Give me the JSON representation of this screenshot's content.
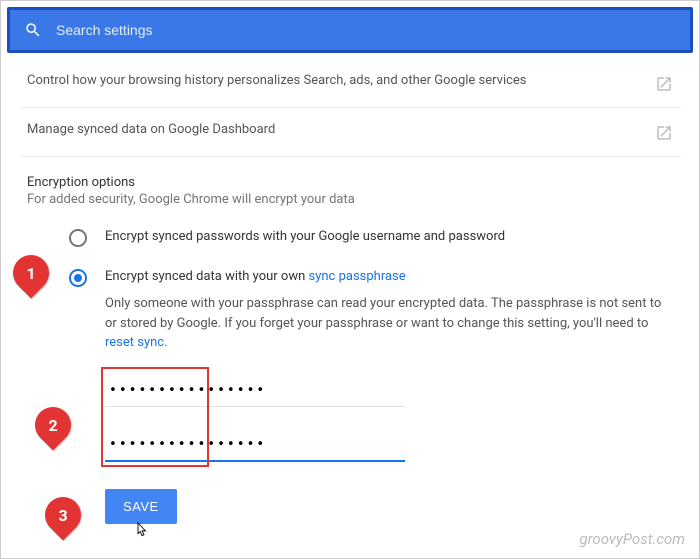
{
  "search": {
    "placeholder": "Search settings"
  },
  "row1": "Control how your browsing history personalizes Search, ads, and other Google services",
  "row2": "Manage synced data on Google Dashboard",
  "encryption": {
    "title": "Encryption options",
    "sub": "For added security, Google Chrome will encrypt your data",
    "opt1": "Encrypt synced passwords with your Google username and password",
    "opt2_prefix": "Encrypt synced data with your own ",
    "opt2_link": "sync passphrase",
    "desc_prefix": "Only someone with your passphrase can read your encrypted data. The passphrase is not sent to or stored by Google. If you forget your passphrase or want to change this setting, you'll need to ",
    "desc_link": "reset sync",
    "desc_suffix": "."
  },
  "passwords": {
    "pw1": "••••••••••••••••",
    "pw2": "••••••••••••••••"
  },
  "save_label": "SAVE",
  "callouts": {
    "c1": "1",
    "c2": "2",
    "c3": "3"
  },
  "watermark": "groovyPost.com"
}
